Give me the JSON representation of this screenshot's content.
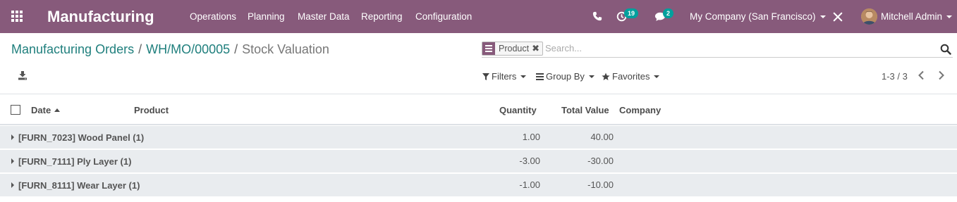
{
  "navbar": {
    "app_title": "Manufacturing",
    "menu": [
      "Operations",
      "Planning",
      "Master Data",
      "Reporting",
      "Configuration"
    ],
    "activity_count": "19",
    "messages_count": "2",
    "company": "My Company (San Francisco)",
    "user": "Mitchell Admin",
    "icons": [
      "apps-grid-icon",
      "phone-icon",
      "activity-clock-icon",
      "chat-icon",
      "debug-tools-icon"
    ]
  },
  "breadcrumb": {
    "items": [
      "Manufacturing Orders",
      "WH/MO/00005"
    ],
    "current": "Stock Valuation",
    "separator": "/"
  },
  "search": {
    "facet_label": "Product",
    "placeholder": "Search..."
  },
  "toolbar": {
    "filters_label": "Filters",
    "groupby_label": "Group By",
    "favorites_label": "Favorites",
    "pager_text": "1-3 / 3"
  },
  "table": {
    "columns": {
      "date": "Date",
      "product": "Product",
      "quantity": "Quantity",
      "total_value": "Total Value",
      "company": "Company"
    },
    "sort": "ascending",
    "groups": [
      {
        "name": "[FURN_7023] Wood Panel (1)",
        "quantity": "1.00",
        "total_value": "40.00"
      },
      {
        "name": "[FURN_7111] Ply Layer (1)",
        "quantity": "-3.00",
        "total_value": "-30.00"
      },
      {
        "name": "[FURN_8111] Wear Layer (1)",
        "quantity": "-1.00",
        "total_value": "-10.00"
      }
    ]
  },
  "colors": {
    "navbar": "#875a7b",
    "link": "#1f7f7d",
    "badge": "#00a09d",
    "group_row": "#e9ecef"
  }
}
